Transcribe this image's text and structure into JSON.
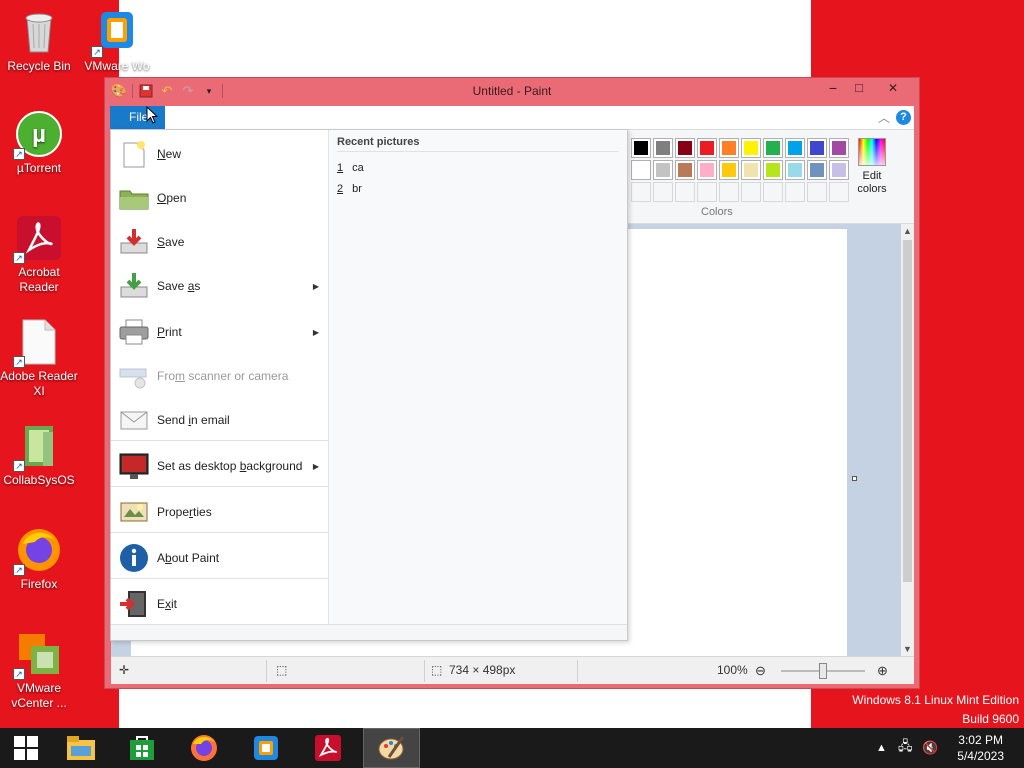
{
  "desktop": {
    "icons": [
      {
        "label": "Recycle Bin",
        "icon": "recycle-bin-icon"
      },
      {
        "label": "VMware Wo",
        "icon": "vmware-workstation-icon"
      },
      {
        "label": "µTorrent",
        "icon": "utorrent-icon"
      },
      {
        "label": "Acrobat Reader",
        "icon": "acrobat-reader-icon"
      },
      {
        "label": "Adobe Reader XI",
        "icon": "adobe-reader-icon"
      },
      {
        "label": "CollabSysOS",
        "icon": "collabsysos-icon"
      },
      {
        "label": "Firefox",
        "icon": "firefox-icon"
      },
      {
        "label": "VMware vCenter ...",
        "icon": "vmware-vcenter-icon"
      }
    ],
    "watermark_line1": "Windows 8.1 Linux Mint Edition",
    "watermark_line2": "Build 9600",
    "background_color": "#e6141d"
  },
  "window": {
    "title": "Untitled - Paint",
    "minimize": "−",
    "maximize": "□",
    "close": "✕",
    "accent": "#ea6b76"
  },
  "ribbon": {
    "file_tab": "File",
    "colors_group": "Colors",
    "edit_colors": "Edit colors",
    "help": "?",
    "palette_row1": [
      "#000000",
      "#7f7f7f",
      "#880015",
      "#ed1c24",
      "#ff7f27",
      "#fff200",
      "#22b14c",
      "#00a2e8",
      "#3f48cc",
      "#a349a4"
    ],
    "palette_row2": [
      "#ffffff",
      "#c3c3c3",
      "#b97a57",
      "#ffaec9",
      "#ffc90e",
      "#efe4b0",
      "#b5e61d",
      "#99d9ea",
      "#7092be",
      "#c8bfe7"
    ],
    "palette_row3": [
      "#ffffff",
      "#ffffff",
      "#ffffff",
      "#ffffff",
      "#ffffff",
      "#ffffff",
      "#ffffff",
      "#ffffff",
      "#ffffff",
      "#ffffff"
    ]
  },
  "file_menu": {
    "items": [
      {
        "label": "New",
        "icon": "new-file-icon",
        "has_arrow": false,
        "disabled": false
      },
      {
        "label": "Open",
        "icon": "open-folder-icon",
        "has_arrow": false,
        "disabled": false
      },
      {
        "label": "Save",
        "icon": "save-icon",
        "has_arrow": false,
        "disabled": false
      },
      {
        "label": "Save as",
        "icon": "save-as-icon",
        "has_arrow": true,
        "disabled": false
      },
      {
        "label": "Print",
        "icon": "printer-icon",
        "has_arrow": true,
        "disabled": false
      },
      {
        "label": "From scanner or camera",
        "icon": "scanner-icon",
        "has_arrow": false,
        "disabled": true
      },
      {
        "label": "Send in email",
        "icon": "email-icon",
        "has_arrow": false,
        "disabled": false
      },
      {
        "label": "Set as desktop background",
        "icon": "desktop-background-icon",
        "has_arrow": true,
        "disabled": false
      },
      {
        "label": "Properties",
        "icon": "properties-icon",
        "has_arrow": false,
        "disabled": false
      },
      {
        "label": "About Paint",
        "icon": "info-icon",
        "has_arrow": false,
        "disabled": false
      },
      {
        "label": "Exit",
        "icon": "exit-icon",
        "has_arrow": false,
        "disabled": false
      }
    ],
    "recent_heading": "Recent pictures",
    "recent": [
      {
        "num": "1",
        "name": "ca"
      },
      {
        "num": "2",
        "name": "br"
      }
    ]
  },
  "statusbar": {
    "dimensions": "734 × 498px",
    "zoom": "100%"
  },
  "taskbar": {
    "time": "3:02 PM",
    "date": "5/4/2023"
  }
}
